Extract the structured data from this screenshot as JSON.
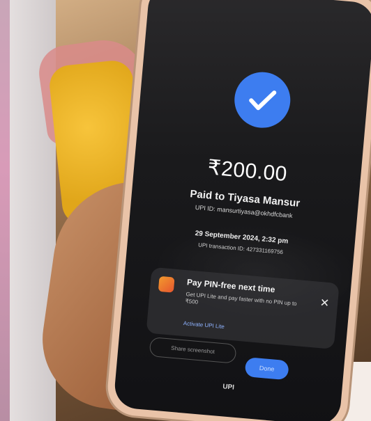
{
  "payment": {
    "amount": "₹200.00",
    "paid_to": "Paid to Tiyasa Mansur",
    "upi_id": "UPI ID: mansurtiyasa@okhdfcbank",
    "date_time": "29 September 2024, 2:32 pm",
    "transaction_id": "UPI transaction ID: 427331169756"
  },
  "promo": {
    "title": "Pay PIN-free next time",
    "body": "Get UPI Lite and pay faster with no PIN up to ₹500",
    "link": "Activate UPI Lite",
    "close_glyph": "✕"
  },
  "actions": {
    "share_label": "Share screenshot",
    "done_label": "Done"
  },
  "footer": {
    "logo_text": "UPI"
  },
  "colors": {
    "accent_blue": "#3d7df0",
    "screen_dark": "#1a1a1c",
    "phone_case": "#e9c3a8"
  },
  "icons": {
    "success": "check-circle-icon",
    "promo": "upi-lite-icon",
    "close": "close-icon"
  }
}
